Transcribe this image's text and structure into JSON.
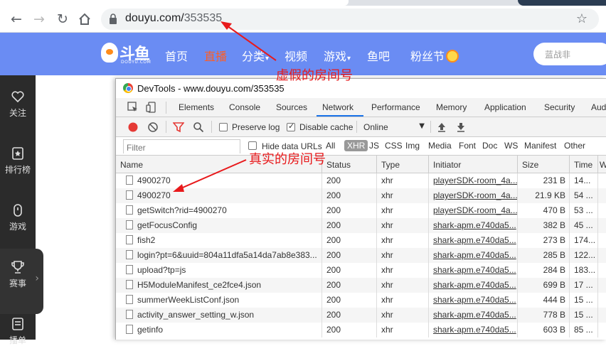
{
  "browser": {
    "url_host": "douyu.com/",
    "url_path": "353535"
  },
  "douyu": {
    "logo_text": "斗鱼",
    "logo_sub": "DOUYU.COM",
    "nav": [
      {
        "label": "首页"
      },
      {
        "label": "直播"
      },
      {
        "label": "分类"
      },
      {
        "label": "视频"
      },
      {
        "label": "游戏"
      },
      {
        "label": "鱼吧"
      },
      {
        "label": "粉丝节"
      }
    ],
    "search_placeholder": "蓝战非",
    "sidebar": [
      {
        "label": "关注",
        "icon": "heart-icon"
      },
      {
        "label": "排行榜",
        "icon": "rank-icon"
      },
      {
        "label": "游戏",
        "icon": "gamepad-icon"
      },
      {
        "label": "赛事",
        "icon": "trophy-icon"
      },
      {
        "label": "播单",
        "icon": "playlist-icon"
      }
    ]
  },
  "devtools": {
    "title": "DevTools - www.douyu.com/353535",
    "tabs": [
      "Elements",
      "Console",
      "Sources",
      "Network",
      "Performance",
      "Memory",
      "Application",
      "Security",
      "Aud"
    ],
    "active_tab": "Network",
    "preserve_log": "Preserve log",
    "disable_cache": "Disable cache",
    "throttle": "Online",
    "filter_placeholder": "Filter",
    "hide_data_urls": "Hide data URLs",
    "types": [
      "All",
      "XHR",
      "JS",
      "CSS",
      "Img",
      "Media",
      "Font",
      "Doc",
      "WS",
      "Manifest",
      "Other"
    ],
    "active_type": "XHR",
    "columns": [
      "Name",
      "Status",
      "Type",
      "Initiator",
      "Size",
      "Time",
      "W"
    ],
    "rows": [
      {
        "name": "4900270",
        "status": "200",
        "type": "xhr",
        "initiator": "playerSDK-room_4a...",
        "size": "231 B",
        "time": "14..."
      },
      {
        "name": "4900270",
        "status": "200",
        "type": "xhr",
        "initiator": "playerSDK-room_4a...",
        "size": "21.9 KB",
        "time": "54 ..."
      },
      {
        "name": "getSwitch?rid=4900270",
        "status": "200",
        "type": "xhr",
        "initiator": "playerSDK-room_4a...",
        "size": "470 B",
        "time": "53 ..."
      },
      {
        "name": "getFocusConfig",
        "status": "200",
        "type": "xhr",
        "initiator": "shark-apm.e740da5...",
        "size": "382 B",
        "time": "45 ..."
      },
      {
        "name": "fish2",
        "status": "200",
        "type": "xhr",
        "initiator": "shark-apm.e740da5...",
        "size": "273 B",
        "time": "174..."
      },
      {
        "name": "login?pt=6&uuid=804a11dfa5a14da7ab8e383...",
        "status": "200",
        "type": "xhr",
        "initiator": "shark-apm.e740da5...",
        "size": "285 B",
        "time": "122..."
      },
      {
        "name": "upload?tp=js",
        "status": "200",
        "type": "xhr",
        "initiator": "shark-apm.e740da5...",
        "size": "284 B",
        "time": "183..."
      },
      {
        "name": "H5ModuleManifest_ce2fce4.json",
        "status": "200",
        "type": "xhr",
        "initiator": "shark-apm.e740da5...",
        "size": "699 B",
        "time": "17 ..."
      },
      {
        "name": "summerWeekListConf.json",
        "status": "200",
        "type": "xhr",
        "initiator": "shark-apm.e740da5...",
        "size": "444 B",
        "time": "15 ..."
      },
      {
        "name": "activity_answer_setting_w.json",
        "status": "200",
        "type": "xhr",
        "initiator": "shark-apm.e740da5...",
        "size": "778 B",
        "time": "15 ..."
      },
      {
        "name": "getinfo",
        "status": "200",
        "type": "xhr",
        "initiator": "shark-apm.e740da5...",
        "size": "603 B",
        "time": "85 ..."
      }
    ]
  },
  "annotations": {
    "fake_room": "虚假的房间号",
    "real_room": "真实的房间号"
  },
  "colors": {
    "douyu_header": "#6a8cf3",
    "active_nav": "#ff5d23",
    "annotation": "#e8191b",
    "devtools_accent": "#1a73e8"
  }
}
